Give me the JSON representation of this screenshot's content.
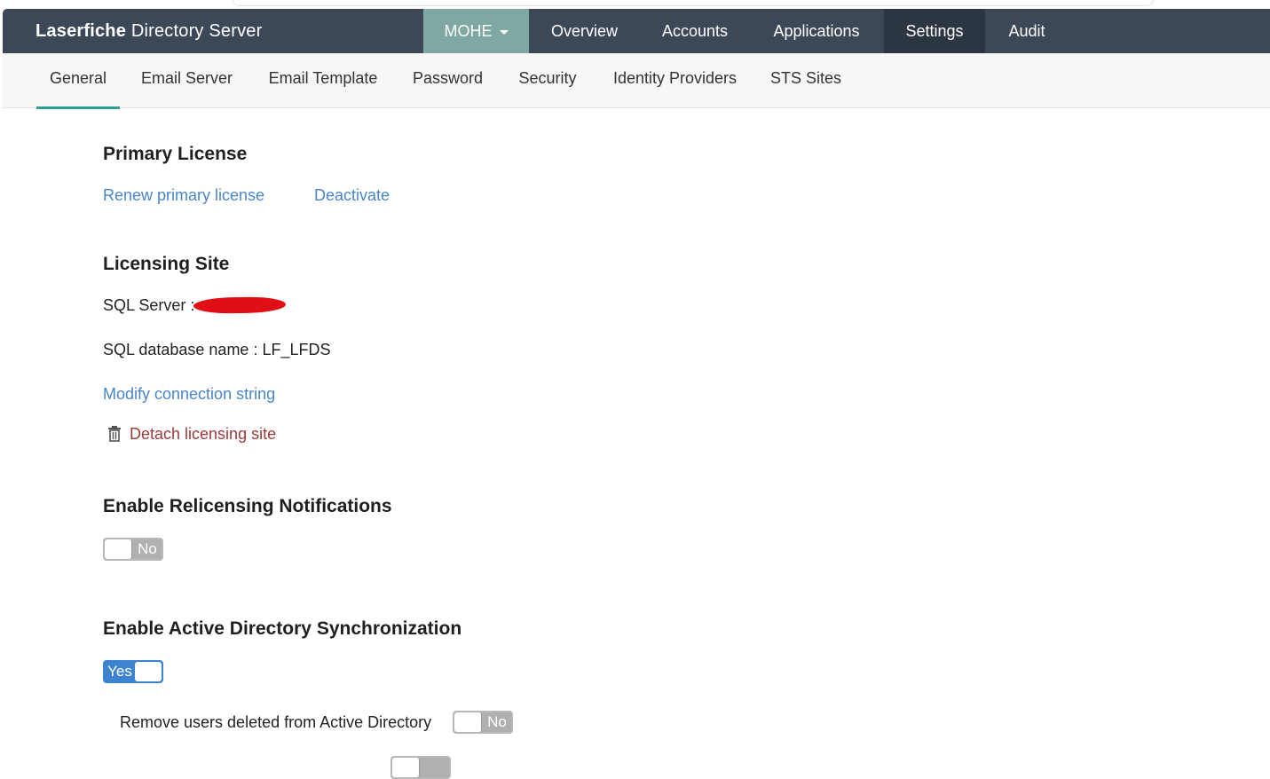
{
  "app": {
    "brand_bold": "Laserfiche",
    "brand_rest": " Directory Server"
  },
  "nav": {
    "org": "MOHE",
    "items": [
      "Overview",
      "Accounts",
      "Applications",
      "Settings",
      "Audit"
    ],
    "active": "Settings"
  },
  "subnav": {
    "tabs": [
      "General",
      "Email Server",
      "Email Template",
      "Password",
      "Security",
      "Identity Providers",
      "STS Sites"
    ],
    "active": "General"
  },
  "primary_license": {
    "title": "Primary License",
    "renew": "Renew primary license",
    "deactivate": "Deactivate"
  },
  "licensing_site": {
    "title": "Licensing Site",
    "sql_server_label": "SQL Server : ",
    "sql_db": "SQL database name : LF_LFDS",
    "modify": "Modify connection string",
    "detach": "Detach licensing site"
  },
  "relicensing": {
    "title": "Enable Relicensing Notifications",
    "toggle": "No"
  },
  "ad_sync": {
    "title": "Enable Active Directory Synchronization",
    "toggle": "Yes",
    "remove_users_label": "Remove users deleted from Active Directory",
    "remove_users_toggle": "No"
  },
  "colors": {
    "navbar": "#3c4858",
    "org_tab": "#7fa8a3",
    "active_nav": "#2c3643",
    "subtab_underline": "#2e9e8f",
    "link": "#4a86c5",
    "danger": "#9b3a3a",
    "toggle_on": "#3d83cf",
    "toggle_off": "#b0b0b0"
  }
}
